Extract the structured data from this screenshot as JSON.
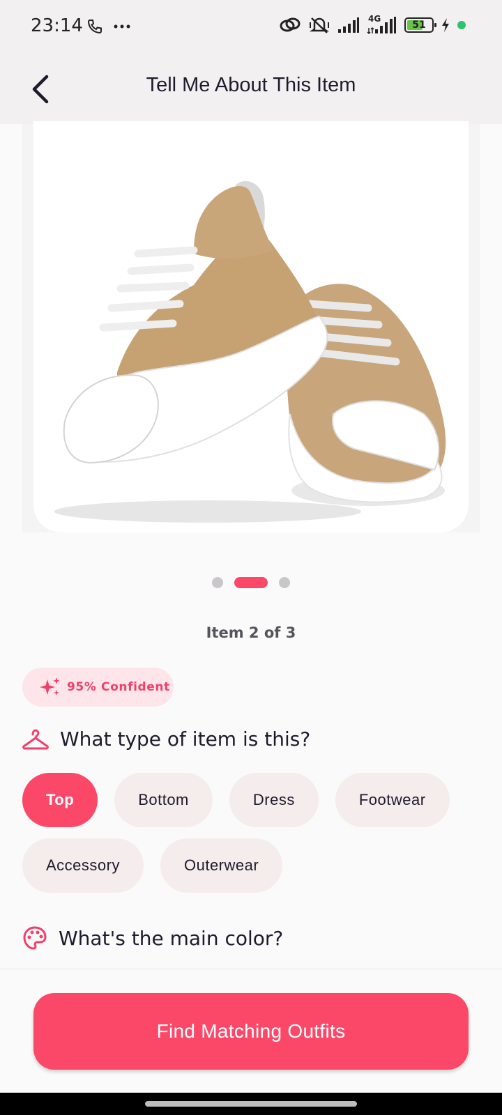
{
  "status_bar": {
    "time": "23:14",
    "network": "4G",
    "battery": "51",
    "icons": [
      "phone-icon",
      "more-dots-icon",
      "link-icon",
      "mute-icon",
      "signal-icon",
      "signal-4g-icon",
      "battery-icon",
      "charging-icon",
      "active-dot"
    ]
  },
  "app_bar": {
    "title": "Tell Me About This Item",
    "back_icon": "chevron-left-icon"
  },
  "carousel": {
    "image_description_icon": "sneaker-photo",
    "pages": 3,
    "active_page": 2,
    "counter": "Item 2 of 3"
  },
  "confidence": {
    "icon": "sparkle-icon",
    "label": "95% Confident"
  },
  "questions": {
    "type": {
      "icon": "hanger-icon",
      "label": "What type of item is this?",
      "options": [
        "Top",
        "Bottom",
        "Dress",
        "Footwear",
        "Accessory",
        "Outerwear"
      ],
      "selected": "Top"
    },
    "color": {
      "icon": "palette-icon",
      "label": "What's the main color?"
    }
  },
  "action": {
    "label": "Find Matching Outfits"
  },
  "colors": {
    "accent": "#fb4869",
    "chip_bg": "#f5ecec",
    "badge_bg": "#fde5e9",
    "app_bar_bg": "#f3f0f1"
  }
}
